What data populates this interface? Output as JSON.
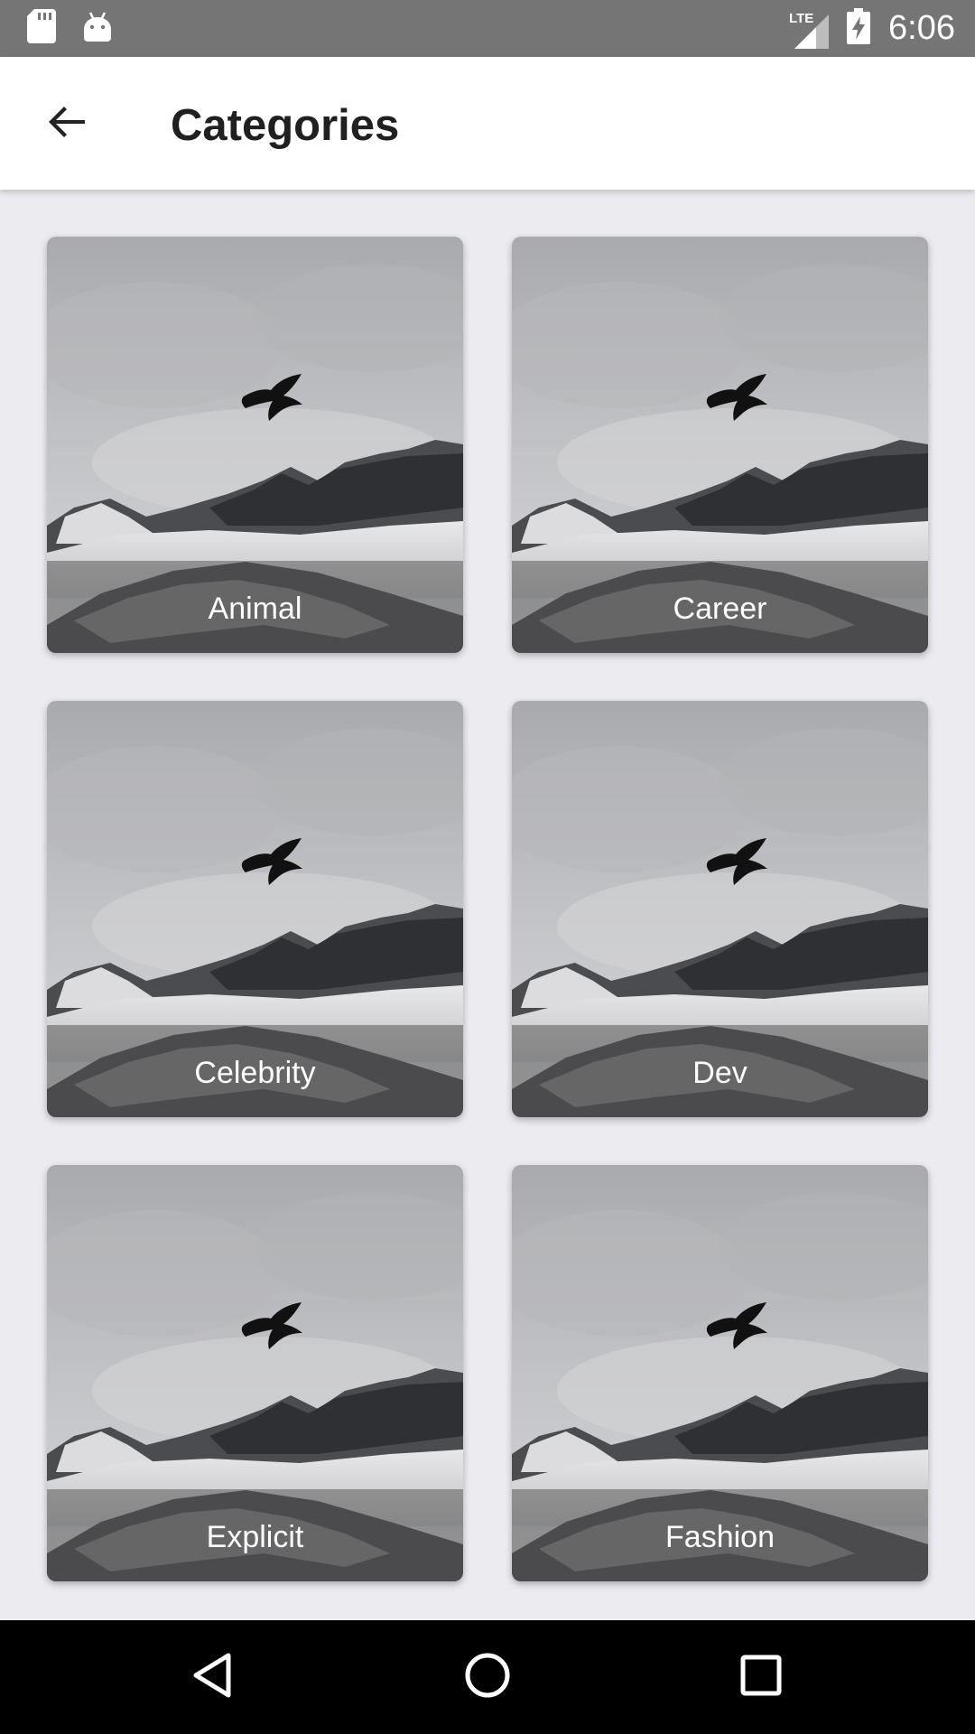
{
  "status_bar": {
    "time": "6:06",
    "network": "LTE",
    "icons": [
      "sd-card-icon",
      "android-icon",
      "signal-icon",
      "battery-charging-icon"
    ]
  },
  "app_bar": {
    "title": "Categories",
    "back_icon": "arrow-back-icon"
  },
  "categories": [
    {
      "label": "Animal"
    },
    {
      "label": "Career"
    },
    {
      "label": "Celebrity"
    },
    {
      "label": "Dev"
    },
    {
      "label": "Explicit"
    },
    {
      "label": "Fashion"
    }
  ],
  "nav_bar": {
    "icons": [
      "back-triangle-icon",
      "home-circle-icon",
      "recents-square-icon"
    ]
  },
  "colors": {
    "status_bar": "#757575",
    "background": "#ebebf0",
    "app_bar": "#ffffff",
    "nav_bar": "#000000"
  }
}
